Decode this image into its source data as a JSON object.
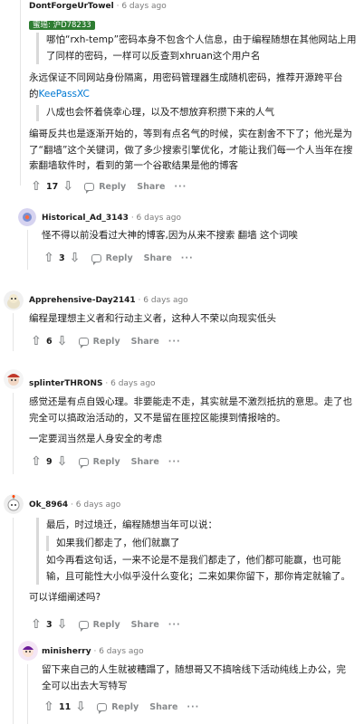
{
  "comment1": {
    "user": "DontForgeUrTowel",
    "time": "6 days ago",
    "flair": "蜜瑶: 沪D78233",
    "quote1": "哪怕“rxh-temp”密码本身不包含个人信息，由于编程随想在其他网站上用了同样的密码，一样可以反查到xhruan这个用户名",
    "p1_before_link": "永远保证不同网站身份隔离，用密码管理器生成随机密码，推荐开源跨平台的",
    "p1_link": "KeePassXC",
    "quote2": "八成也会怀着侥幸心理，以及不想放弃积攒下来的人气",
    "p2": "编哥反共也是逐渐开始的，等到有点名气的时候，实在割舍不下了；他光是为了“翻墙”这个关键词，做了多少搜索引擎优化，才能让我们每一个人当年在搜索翻墙软件时，看到的第一个谷歌结果是他的博客",
    "votes": "17",
    "reply": "Reply",
    "share": "Share",
    "more": "···"
  },
  "comment2": {
    "user": "Historical_Ad_3143",
    "time": "6 days ago",
    "text": "怪不得以前没看过大神的博客,因为从来不搜索 翻墙 这个词唉",
    "votes": "3",
    "reply": "Reply",
    "share": "Share",
    "more": "···"
  },
  "comment3": {
    "user": "Apprehensive-Day2141",
    "time": "6 days ago",
    "text": "编程是理想主义者和行动主义者，这种人不荣以向现实低头",
    "votes": "6",
    "reply": "Reply",
    "share": "Share",
    "more": "···"
  },
  "comment4": {
    "user": "splinterTHRONS",
    "time": "6 days ago",
    "p1": "感觉还是有点自毁心理。非要能走不走，其实就是不激烈抵抗的意思。走了也完全可以搞政治活动的，又不是留在匪控区能摸到情报啥的。",
    "p2": "一定要润当然是人身安全的考虑",
    "votes": "9",
    "reply": "Reply",
    "share": "Share",
    "more": "···"
  },
  "comment5": {
    "user": "Ok_8964",
    "time": "6 days ago",
    "q1": "最后，时过境迁，编程随想当年可以说：",
    "q2": "如果我们都走了，他们就赢了",
    "q3": "如今再看这句话，一来不论是不是我们都走了，他们都可能赢，也可能输，且可能性大小似乎没什么变化；二来如果你留下，那你肯定就输了。",
    "text": "可以详细阐述吗?",
    "votes": "3",
    "reply": "Reply",
    "share": "Share",
    "more": "···"
  },
  "comment6": {
    "user": "minisherry",
    "time": "6 days ago",
    "text": "留下来自己的人生就被糟蹋了，随想哥又不搞啥线下活动纯线上办公，完全可以出去大写特写",
    "votes": "11",
    "reply": "Reply",
    "share": "Share",
    "more": "···"
  },
  "colors": {
    "link": "#0079d3",
    "flair_bg": "#2e7d32",
    "muted": "#878a8c",
    "thread_line": "#e5e5e5"
  }
}
